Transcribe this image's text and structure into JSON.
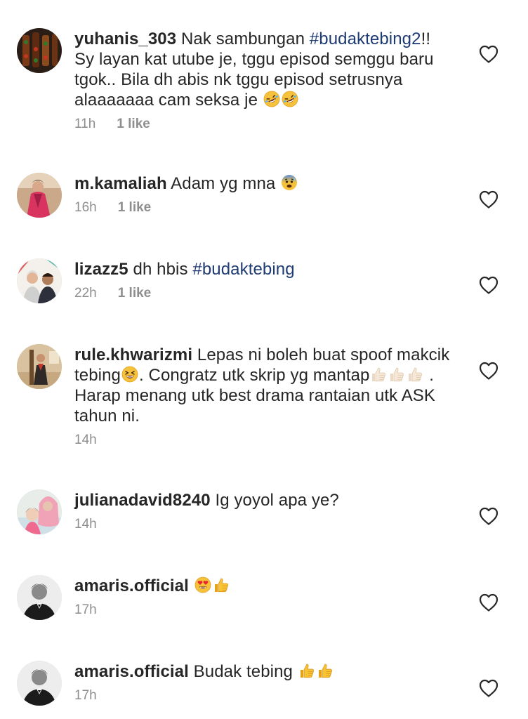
{
  "comments": [
    {
      "username": "yuhanis_303",
      "parts": [
        {
          "t": " Nak sambungan "
        },
        {
          "t": "#budaktebing2",
          "tag": true
        },
        {
          "t": "!! Sy layan kat utube je, tggu episod semggu baru tgok.. Bila dh abis nk tggu episod setrusnya alaaaaaaa cam seksa je "
        },
        {
          "emoji": "rofl"
        },
        {
          "emoji": "rofl"
        }
      ],
      "time": "11h",
      "likes": "1 like",
      "avatar": "food-skewers"
    },
    {
      "username": "m.kamaliah",
      "parts": [
        {
          "t": " Adam yg mna "
        },
        {
          "emoji": "anxious"
        }
      ],
      "time": "16h",
      "likes": "1 like",
      "avatar": "woman-pink"
    },
    {
      "username": "lizazz5",
      "parts": [
        {
          "t": " dh hbis "
        },
        {
          "t": "#budaktebing",
          "tag": true
        }
      ],
      "time": "22h",
      "likes": "1 like",
      "avatar": "couple"
    },
    {
      "username": "rule.khwarizmi",
      "parts": [
        {
          "t": " Lepas ni boleh buat spoof makcik tebing"
        },
        {
          "emoji": "laugh"
        },
        {
          "t": ". Congratz utk skrip yg mantap"
        },
        {
          "emoji": "thumb-light"
        },
        {
          "emoji": "thumb-light"
        },
        {
          "emoji": "thumb-light"
        },
        {
          "t": " . Harap menang utk best drama rantaian utk ASK tahun ni."
        }
      ],
      "time": "14h",
      "likes": "",
      "avatar": "man-stage"
    },
    {
      "username": "julianadavid8240",
      "parts": [
        {
          "t": " Ig yoyol apa ye?"
        }
      ],
      "time": "14h",
      "likes": "",
      "avatar": "mother-child"
    },
    {
      "username": "amaris.official",
      "parts": [
        {
          "t": " "
        },
        {
          "emoji": "heart-eyes"
        },
        {
          "emoji": "thumb"
        }
      ],
      "time": "17h",
      "likes": "",
      "avatar": "man-bw"
    },
    {
      "username": "amaris.official",
      "parts": [
        {
          "t": " Budak tebing "
        },
        {
          "emoji": "thumb"
        },
        {
          "emoji": "thumb"
        }
      ],
      "time": "17h",
      "likes": "",
      "avatar": "man-bw"
    }
  ],
  "icons": {
    "like": "heart-outline-icon"
  },
  "colors": {
    "text": "#262626",
    "hashtag": "#1f3b73",
    "meta": "#8e8e8e",
    "heart_stroke": "#262626"
  }
}
